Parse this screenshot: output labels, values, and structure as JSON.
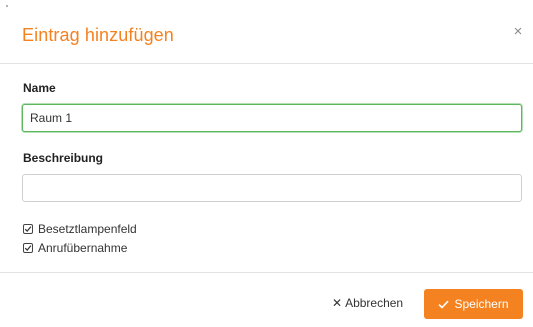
{
  "dialog": {
    "title": "Eintrag hinzufügen",
    "close_glyph": "×",
    "close_icon": "close-icon",
    "accent_color": "#f58220",
    "focus_color": "#5cb85c"
  },
  "form": {
    "name_label": "Name",
    "name_value": "Raum 1",
    "description_label": "Beschreibung",
    "description_value": "",
    "checkboxes": [
      {
        "label": "Besetztlampenfeld",
        "checked": true
      },
      {
        "label": "Anrufübernahme",
        "checked": true
      }
    ]
  },
  "footer": {
    "cancel_label": "Abbrechen",
    "cancel_icon": "x-icon",
    "save_label": "Speichern",
    "save_icon": "check-icon"
  }
}
